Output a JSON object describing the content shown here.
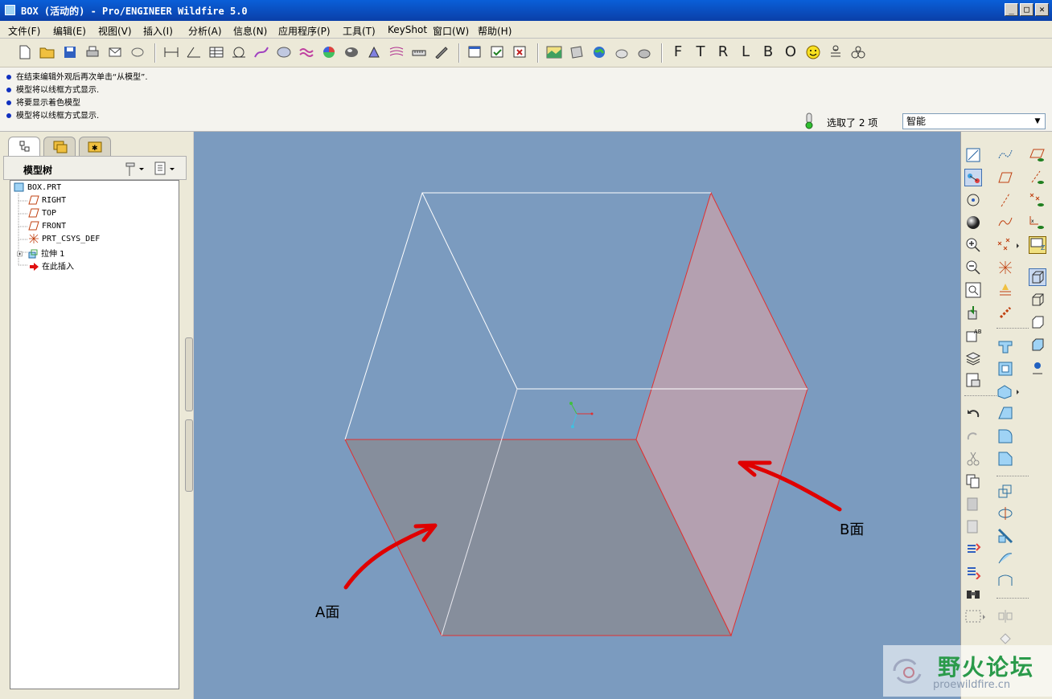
{
  "window": {
    "title": "BOX (活动的) - Pro/ENGINEER Wildfire 5.0",
    "controls": [
      "_",
      "□",
      "✕"
    ]
  },
  "menu": [
    "文件(F)",
    "编辑(E)",
    "视图(V)",
    "插入(I)",
    "分析(A)",
    "信息(N)",
    "应用程序(P)",
    "工具(T)",
    "KeyShot",
    "窗口(W)",
    "帮助(H)"
  ],
  "toolbar": {
    "view_letters": [
      "F",
      "T",
      "R",
      "L",
      "B",
      "O"
    ]
  },
  "messages": [
    "在结束编辑外观后再次单击“从模型”.",
    "模型将以线框方式显示.",
    "将要显示着色模型",
    "模型将以线框方式显示."
  ],
  "status": {
    "selection": "选取了 2 项",
    "filter": "智能"
  },
  "model_tree": {
    "title": "模型树",
    "items": [
      {
        "label": "BOX.PRT",
        "icon": "part-icon"
      },
      {
        "label": "RIGHT",
        "icon": "datum-plane-icon"
      },
      {
        "label": "TOP",
        "icon": "datum-plane-icon"
      },
      {
        "label": "FRONT",
        "icon": "datum-plane-icon"
      },
      {
        "label": "PRT_CSYS_DEF",
        "icon": "csys-icon"
      },
      {
        "label": "拉伸 1",
        "icon": "extrude-icon"
      },
      {
        "label": "在此插入",
        "icon": "insert-arrow-icon"
      }
    ]
  },
  "annotations": {
    "face_a": "A面",
    "face_b": "B面"
  },
  "colors": {
    "viewport_bg": "#7b9bbf",
    "highlight_edge": "#e03030",
    "annotation_arrow": "#e00000"
  },
  "watermark": {
    "text": "野火论坛",
    "url": "proewildfire.cn"
  }
}
